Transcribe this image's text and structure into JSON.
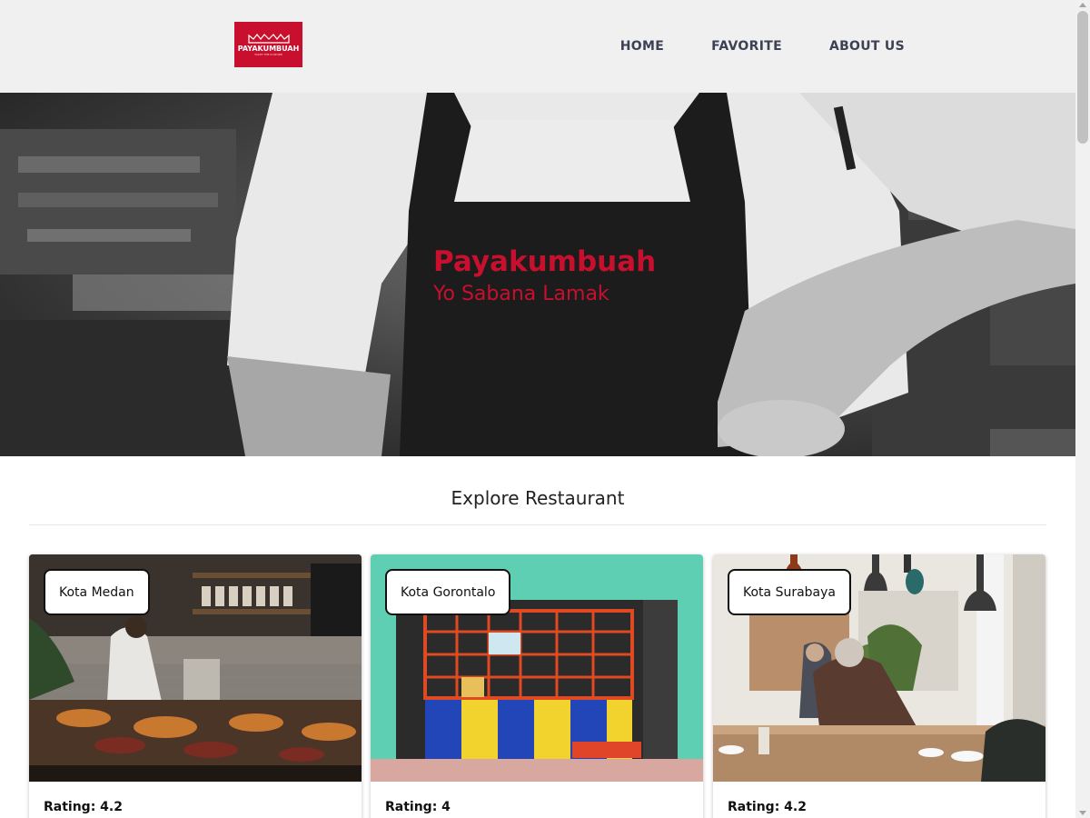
{
  "header": {
    "logo_text": "PAYAKUMBUAH",
    "logo_subtext": "TASTE THE CULTURE",
    "nav": [
      {
        "label": "HOME"
      },
      {
        "label": "FAVORITE"
      },
      {
        "label": "ABOUT US"
      }
    ]
  },
  "hero": {
    "title": "Payakumbuah",
    "subtitle": "Yo Sabana Lamak"
  },
  "explore": {
    "title": "Explore Restaurant"
  },
  "restaurants": [
    {
      "city": "Kota Medan",
      "rating": "Rating: 4.2"
    },
    {
      "city": "Kota Gorontalo",
      "rating": "Rating: 4"
    },
    {
      "city": "Kota Surabaya",
      "rating": "Rating: 4.2"
    }
  ],
  "colors": {
    "brand_red": "#c8102e",
    "header_bg": "#f0f0f0",
    "nav_text": "#3d4155"
  },
  "icons": [
    "logo-crown-icon",
    "scroll-up-arrow-icon",
    "scroll-down-arrow-icon"
  ]
}
